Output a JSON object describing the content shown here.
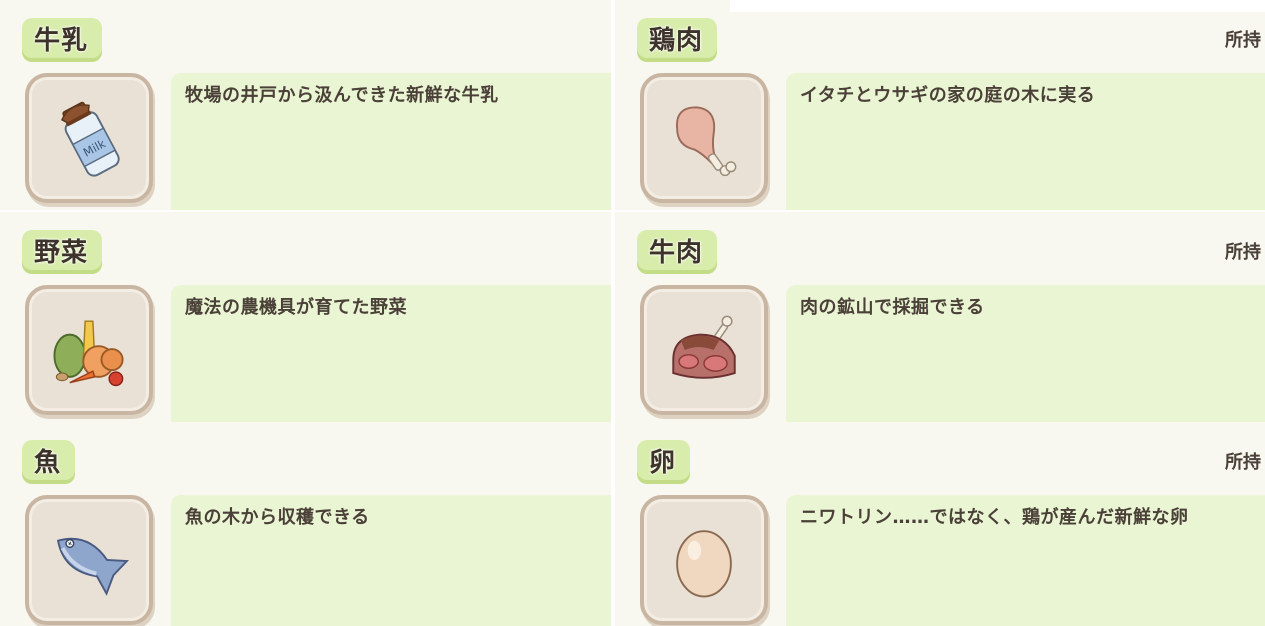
{
  "items": [
    {
      "title": "牛乳",
      "description": "牧場の井戸から汲んできた新鮮な牛乳",
      "icon": "milk-bottle-icon",
      "owned_label": ""
    },
    {
      "title": "鶏肉",
      "description": "イタチとウサギの家の庭の木に実る",
      "icon": "chicken-leg-icon",
      "owned_label": "所持"
    },
    {
      "title": "野菜",
      "description": "魔法の農機具が育てた野菜",
      "icon": "vegetables-icon",
      "owned_label": ""
    },
    {
      "title": "牛肉",
      "description": "肉の鉱山で採掘できる",
      "icon": "beef-steak-icon",
      "owned_label": "所持"
    },
    {
      "title": "魚",
      "description": "魚の木から収穫できる",
      "icon": "fish-icon",
      "owned_label": ""
    },
    {
      "title": "卵",
      "description": "ニワトリン……ではなく、鶏が産んだ新鮮な卵",
      "icon": "egg-icon",
      "owned_label": "所持"
    }
  ],
  "colors": {
    "title_tab": "#d8ecab",
    "description_box": "#eaf5d3",
    "card_background": "#f8f8f0",
    "icon_frame": "#e9e1d6",
    "icon_frame_border": "#c9b6a2",
    "text": "#3e332b"
  }
}
